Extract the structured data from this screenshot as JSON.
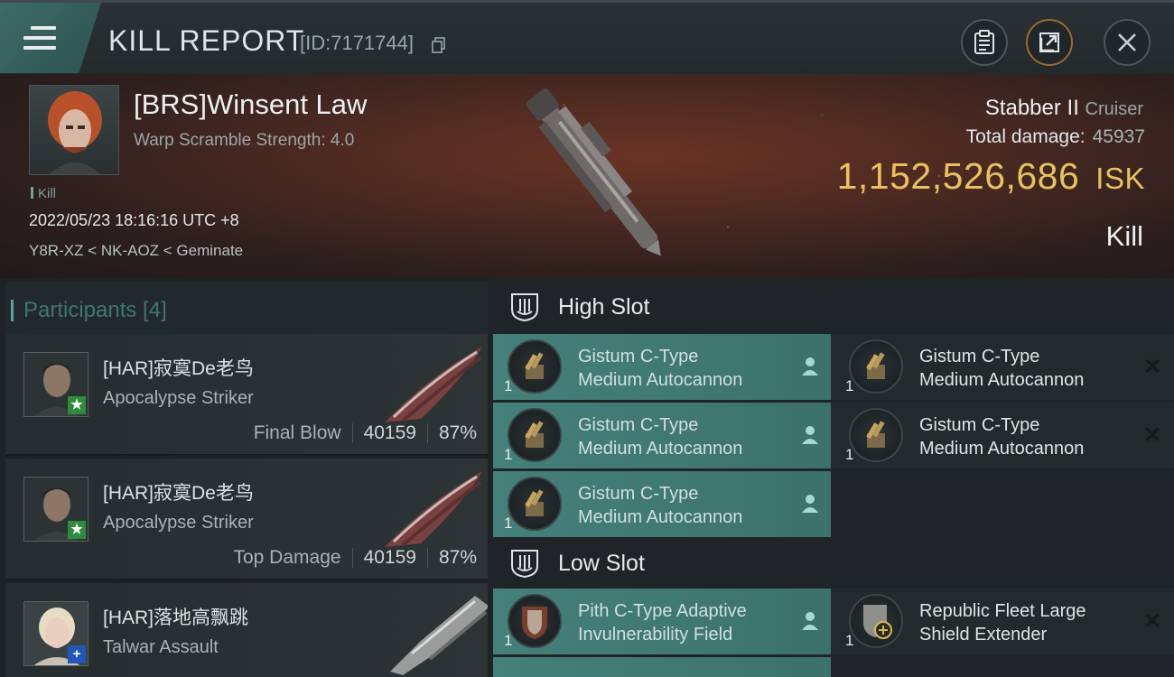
{
  "header": {
    "title": "KILL REPORT",
    "report_id": "[ID:7171744]"
  },
  "victim": {
    "name": "[BRS]Winsent Law",
    "subtitle": "Warp Scramble Strength: 4.0",
    "tag": "Kill",
    "time": "2022/05/23 18:16:16 UTC +8",
    "location": "Y8R-XZ < NK-AOZ < Geminate",
    "ship_name": "Stabber II",
    "ship_class": "Cruiser",
    "total_damage_label": "Total damage:",
    "total_damage": "45937",
    "isk_value": "1,152,526,686",
    "isk_unit": "ISK",
    "result": "Kill"
  },
  "participants": {
    "label": "Participants [4]",
    "rows": [
      {
        "name": "[HAR]寂寞De老鸟",
        "ship": "Apocalypse Striker",
        "role": "Final Blow",
        "damage": "40159",
        "percent": "87%",
        "badge": "★"
      },
      {
        "name": "[HAR]寂寞De老鸟",
        "ship": "Apocalypse Striker",
        "role": "Top Damage",
        "damage": "40159",
        "percent": "87%",
        "badge": "★"
      },
      {
        "name": "[HAR]落地高飘跳",
        "ship": "Talwar Assault",
        "badge": "+"
      }
    ]
  },
  "fitting": {
    "high_slot_label": "High Slot",
    "low_slot_label": "Low Slot",
    "high_modules": [
      {
        "name_line1": "Gistum C-Type",
        "name_line2": "Medium Autocannon",
        "qty": "1",
        "state": "dropped"
      },
      {
        "name_line1": "Gistum C-Type",
        "name_line2": "Medium Autocannon",
        "qty": "1",
        "state": "destroyed"
      },
      {
        "name_line1": "Gistum C-Type",
        "name_line2": "Medium Autocannon",
        "qty": "1",
        "state": "dropped"
      },
      {
        "name_line1": "Gistum C-Type",
        "name_line2": "Medium Autocannon",
        "qty": "1",
        "state": "destroyed"
      },
      {
        "name_line1": "Gistum C-Type",
        "name_line2": "Medium Autocannon",
        "qty": "1",
        "state": "dropped"
      }
    ],
    "low_modules": [
      {
        "name_line1": "Pith C-Type Adaptive",
        "name_line2": "Invulnerability Field",
        "qty": "1",
        "state": "dropped"
      },
      {
        "name_line1": "Republic Fleet Large",
        "name_line2": "Shield Extender",
        "qty": "1",
        "state": "destroyed"
      }
    ]
  },
  "colors": {
    "accent_teal": "#45807a",
    "isk_gold": "#e8c25e"
  }
}
